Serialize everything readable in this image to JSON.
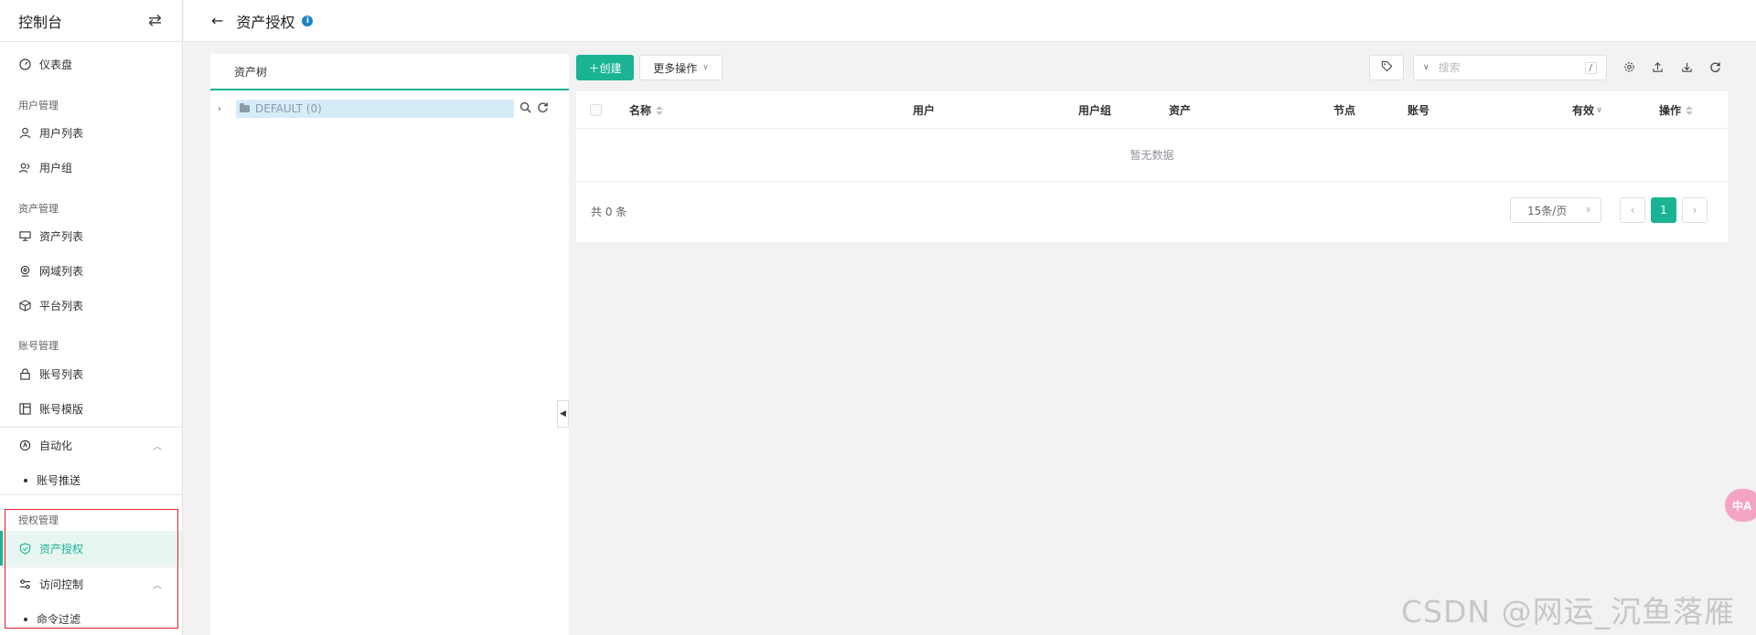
{
  "sidebar": {
    "title": "控制台",
    "dashboard": "仪表盘",
    "groups": {
      "users": "用户管理",
      "assets": "资产管理",
      "accounts": "账号管理",
      "perms": "授权管理"
    },
    "items": {
      "user_list": "用户列表",
      "user_group": "用户组",
      "asset_list": "资产列表",
      "zone_list": "网域列表",
      "platform_list": "平台列表",
      "account_list": "账号列表",
      "account_template": "账号模版",
      "automation": "自动化",
      "account_push": "账号推送",
      "asset_perm": "资产授权",
      "access_control": "访问控制",
      "cmd_filter": "命令过滤"
    }
  },
  "header": {
    "title": "资产授权"
  },
  "tree": {
    "tab": "资产树",
    "node": "DEFAULT (0)"
  },
  "toolbar": {
    "create": "创建",
    "more": "更多操作",
    "search_placeholder": "搜索",
    "shortcut": "/"
  },
  "table": {
    "columns": [
      "名称",
      "用户",
      "用户组",
      "资产",
      "节点",
      "账号",
      "有效",
      "操作"
    ],
    "empty": "暂无数据",
    "total": "共 0 条",
    "page_size": "15条/页",
    "current_page": "1"
  },
  "watermark": "CSDN @网运_沉鱼落雁",
  "translate_badge": "中A",
  "colors": {
    "accent": "#1ab394",
    "highlight_box": "#e5202b"
  }
}
